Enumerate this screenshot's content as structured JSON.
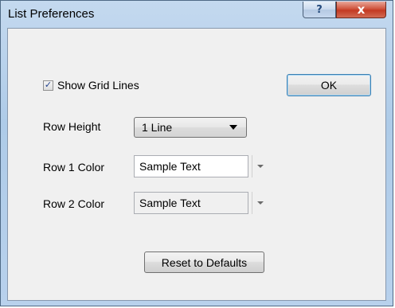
{
  "window": {
    "title": "List Preferences",
    "help_label": "?",
    "close_label": "x"
  },
  "options": {
    "show_grid_lines": {
      "label": "Show Grid Lines",
      "checked": true,
      "check_mark": "✓"
    },
    "row_height": {
      "label": "Row Height",
      "value": "1 Line"
    },
    "row1_color": {
      "label": "Row 1 Color",
      "value": "Sample Text",
      "background": "#ffffff"
    },
    "row2_color": {
      "label": "Row 2 Color",
      "value": "Sample Text",
      "background": "#f0f0f0"
    }
  },
  "buttons": {
    "ok": "OK",
    "reset": "Reset to Defaults"
  }
}
